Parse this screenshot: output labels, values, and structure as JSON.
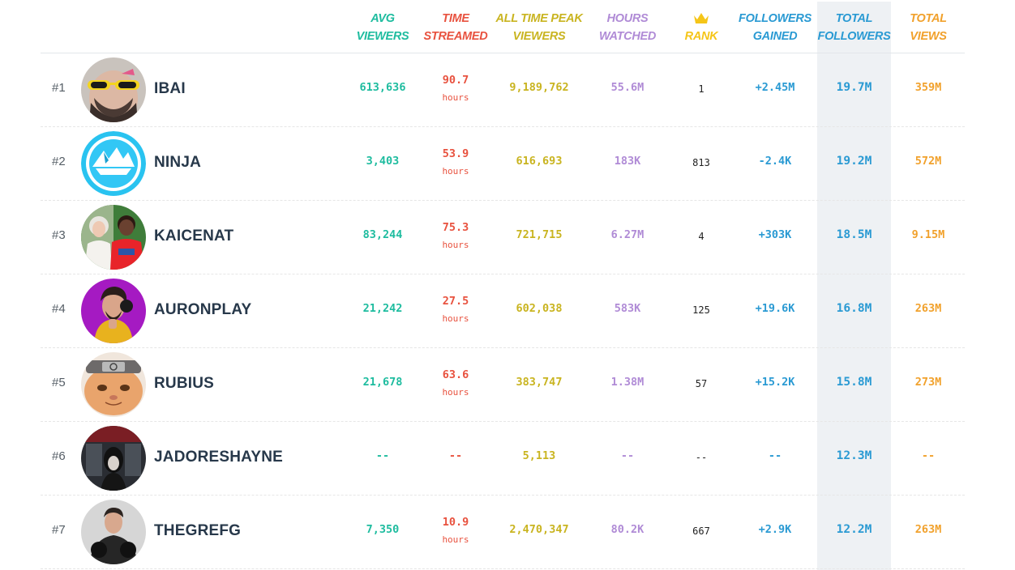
{
  "headers": {
    "avg_viewers": [
      "AVG",
      "VIEWERS"
    ],
    "time_streamed": [
      "TIME",
      "STREAMED"
    ],
    "peak_viewers": [
      "ALL TIME PEAK",
      "VIEWERS"
    ],
    "hours_watched": [
      "HOURS",
      "WATCHED"
    ],
    "rank": "RANK",
    "followers_gained": [
      "FOLLOWERS",
      "GAINED"
    ],
    "total_followers": [
      "TOTAL",
      "FOLLOWERS"
    ],
    "total_views": [
      "TOTAL",
      "VIEWS"
    ]
  },
  "colors": {
    "avg": "#1ebc9f",
    "time": "#e8523f",
    "peak": "#c9b420",
    "hours": "#b08bd6",
    "rank": "#f5c518",
    "followers": "#2a9ad3",
    "views": "#f1a12c",
    "name": "#27384a"
  },
  "rows": [
    {
      "rank": "#1",
      "name": "IBAI",
      "avatar": "ibai-avatar",
      "avg": "613,636",
      "time": "90.7",
      "time_unit": "hours",
      "peak": "9,189,762",
      "hours": "55.6M",
      "rankval": "1",
      "gained": "+2.45M",
      "total_followers": "19.7M",
      "views": "359M"
    },
    {
      "rank": "#2",
      "name": "NINJA",
      "avatar": "ninja-avatar",
      "avg": "3,403",
      "time": "53.9",
      "time_unit": "hours",
      "peak": "616,693",
      "hours": "183K",
      "rankval": "813",
      "gained": "-2.4K",
      "total_followers": "19.2M",
      "views": "572M"
    },
    {
      "rank": "#3",
      "name": "KAICENAT",
      "avatar": "kaicenat-avatar",
      "avg": "83,244",
      "time": "75.3",
      "time_unit": "hours",
      "peak": "721,715",
      "hours": "6.27M",
      "rankval": "4",
      "gained": "+303K",
      "total_followers": "18.5M",
      "views": "9.15M"
    },
    {
      "rank": "#4",
      "name": "AURONPLAY",
      "avatar": "auronplay-avatar",
      "avg": "21,242",
      "time": "27.5",
      "time_unit": "hours",
      "peak": "602,038",
      "hours": "583K",
      "rankval": "125",
      "gained": "+19.6K",
      "total_followers": "16.8M",
      "views": "263M"
    },
    {
      "rank": "#5",
      "name": "RUBIUS",
      "avatar": "rubius-avatar",
      "avg": "21,678",
      "time": "63.6",
      "time_unit": "hours",
      "peak": "383,747",
      "hours": "1.38M",
      "rankval": "57",
      "gained": "+15.2K",
      "total_followers": "15.8M",
      "views": "273M"
    },
    {
      "rank": "#6",
      "name": "JADORESHAYNE",
      "avatar": "jadoreshayne-avatar",
      "avg": "--",
      "time": "--",
      "time_unit": "",
      "peak": "5,113",
      "hours": "--",
      "rankval": "--",
      "gained": "--",
      "total_followers": "12.3M",
      "views": "--"
    },
    {
      "rank": "#7",
      "name": "THEGREFG",
      "avatar": "thegrefg-avatar",
      "avg": "7,350",
      "time": "10.9",
      "time_unit": "hours",
      "peak": "2,470,347",
      "hours": "80.2K",
      "rankval": "667",
      "gained": "+2.9K",
      "total_followers": "12.2M",
      "views": "263M"
    }
  ]
}
